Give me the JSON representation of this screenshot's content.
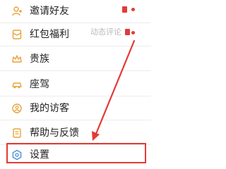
{
  "menu": {
    "items": [
      {
        "label": "邀请好友",
        "icon": "invite-friend-icon"
      },
      {
        "label": "红包福利",
        "icon": "red-packet-icon"
      },
      {
        "label": "贵族",
        "icon": "crown-icon"
      },
      {
        "label": "座驾",
        "icon": "car-icon"
      },
      {
        "label": "我的访客",
        "icon": "visitor-icon"
      },
      {
        "label": "帮助与反馈",
        "icon": "help-feedback-icon"
      },
      {
        "label": "设置",
        "icon": "settings-icon"
      }
    ]
  },
  "watermark": {
    "text": "动态评论"
  },
  "colors": {
    "icon_orange": "#e8a33a",
    "accent_red": "#e53935",
    "text": "#222222"
  }
}
